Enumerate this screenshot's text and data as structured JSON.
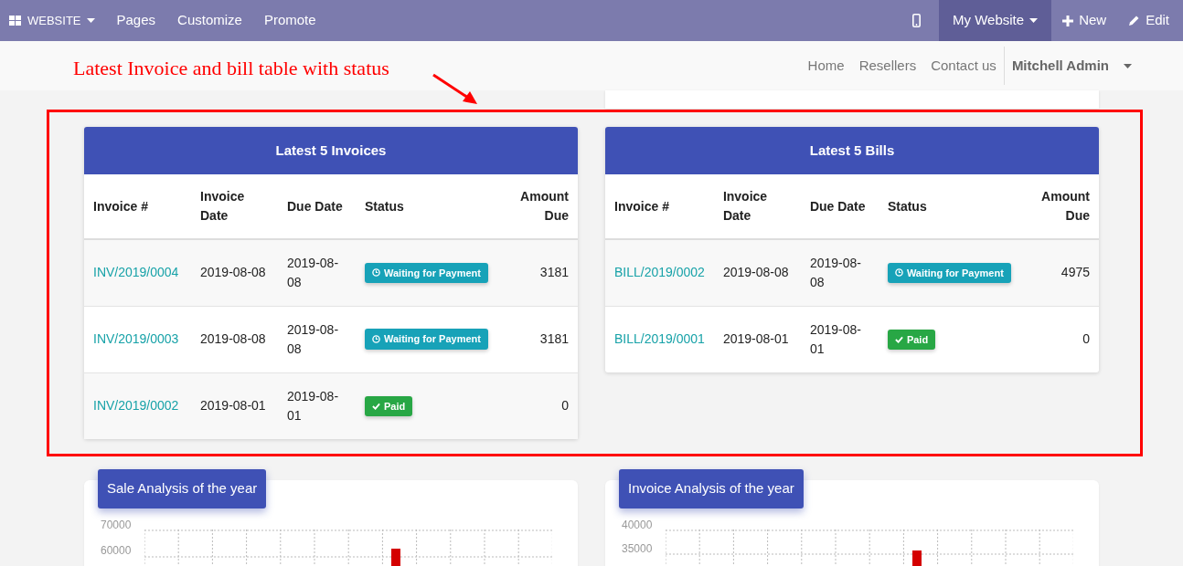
{
  "top_bar": {
    "app_menu": "WEBSITE",
    "items": [
      "Pages",
      "Customize",
      "Promote"
    ],
    "right": [
      {
        "kind": "mobile",
        "selected": false
      },
      {
        "kind": "dropdown",
        "label": "My Website",
        "selected": true
      },
      {
        "kind": "new",
        "label": "New",
        "selected": false
      },
      {
        "kind": "edit",
        "label": "Edit",
        "selected": false
      }
    ]
  },
  "site_nav": {
    "links": [
      "Home",
      "Resellers",
      "Contact us"
    ],
    "user": "Mitchell Admin"
  },
  "annotation": {
    "text": "Latest Invoice and bill table with status"
  },
  "tables": [
    {
      "title": "Latest 5 Invoices",
      "columns": [
        "Invoice #",
        "Invoice Date",
        "Due Date",
        "Status",
        "Amount Due"
      ],
      "rows": [
        {
          "number": "INV/2019/0004",
          "invoice_date": "2019-08-08",
          "due_date": "2019-08-08",
          "status": {
            "kind": "waiting",
            "label": "Waiting for Payment"
          },
          "amount": "3181"
        },
        {
          "number": "INV/2019/0003",
          "invoice_date": "2019-08-08",
          "due_date": "2019-08-08",
          "status": {
            "kind": "waiting",
            "label": "Waiting for Payment"
          },
          "amount": "3181"
        },
        {
          "number": "INV/2019/0002",
          "invoice_date": "2019-08-01",
          "due_date": "2019-08-01",
          "status": {
            "kind": "paid",
            "label": "Paid"
          },
          "amount": "0"
        }
      ]
    },
    {
      "title": "Latest 5 Bills",
      "columns": [
        "Invoice #",
        "Invoice Date",
        "Due Date",
        "Status",
        "Amount Due"
      ],
      "rows": [
        {
          "number": "BILL/2019/0002",
          "invoice_date": "2019-08-08",
          "due_date": "2019-08-08",
          "status": {
            "kind": "waiting",
            "label": "Waiting for Payment"
          },
          "amount": "4975"
        },
        {
          "number": "BILL/2019/0001",
          "invoice_date": "2019-08-01",
          "due_date": "2019-08-01",
          "status": {
            "kind": "paid",
            "label": "Paid"
          },
          "amount": "0"
        }
      ]
    }
  ],
  "charts": [
    {
      "title": "Sale Analysis of the year",
      "y_labels": [
        "70000",
        "60000"
      ]
    },
    {
      "title": "Invoice Analysis of the year",
      "y_labels": [
        "40000",
        "35000"
      ]
    }
  ]
}
